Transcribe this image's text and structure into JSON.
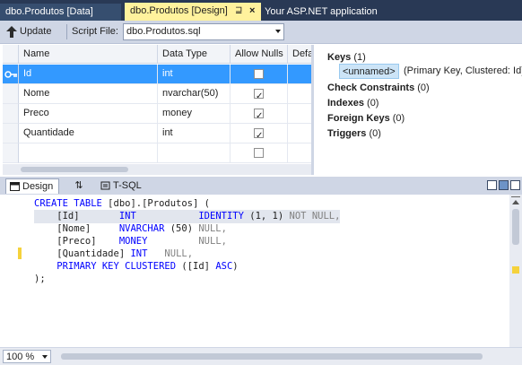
{
  "tabs": [
    {
      "label": "dbo.Produtos [Data]",
      "active": false
    },
    {
      "label": "dbo.Produtos [Design]",
      "active": true,
      "pin": "⊒",
      "close": "×"
    },
    {
      "label": "Your ASP.NET application",
      "active": false
    }
  ],
  "toolbar": {
    "update_label": "Update",
    "script_file_label": "Script File:",
    "script_file_value": "dbo.Produtos.sql"
  },
  "grid": {
    "headers": [
      "Name",
      "Data Type",
      "Allow Nulls",
      "Defa"
    ],
    "rows": [
      {
        "name": "Id",
        "type": "int",
        "allow_nulls": false,
        "key": true
      },
      {
        "name": "Nome",
        "type": "nvarchar(50)",
        "allow_nulls": true,
        "key": false
      },
      {
        "name": "Preco",
        "type": "money",
        "allow_nulls": true,
        "key": false
      },
      {
        "name": "Quantidade",
        "type": "int",
        "allow_nulls": true,
        "key": false
      },
      {
        "name": "",
        "type": "",
        "allow_nulls": false,
        "key": false
      }
    ]
  },
  "properties": {
    "keys": {
      "label": "Keys",
      "count": "(1)"
    },
    "key_item": "<unnamed>",
    "key_desc": "(Primary Key, Clustered: Id)",
    "check_constraints": {
      "label": "Check Constraints",
      "count": "(0)"
    },
    "indexes": {
      "label": "Indexes",
      "count": "(0)"
    },
    "foreign_keys": {
      "label": "Foreign Keys",
      "count": "(0)"
    },
    "triggers": {
      "label": "Triggers",
      "count": "(0)"
    }
  },
  "lower_tabs": {
    "design": "Design",
    "swap": "⇅",
    "tsql": "T-SQL"
  },
  "sql": {
    "l1_kw": "CREATE TABLE",
    "l1_rest": " [dbo].[Produtos] (",
    "l2_col": "    [Id]",
    "l2_type": "INT",
    "l2_ident": "IDENTITY",
    "l2_args": " (1, 1)",
    "l2_null": "NOT NULL,",
    "l3_col": "    [Nome]",
    "l3_type": "NVARCHAR",
    "l3_args": " (50)",
    "l3_null": "NULL,",
    "l4_col": "    [Preco]",
    "l4_type": "MONEY",
    "l4_null": "NULL,",
    "l5_col": "    [Quantidade]",
    "l5_type": "INT",
    "l5_null": "NULL,",
    "l6_kw": "    PRIMARY KEY CLUSTERED",
    "l6_rest": " ([Id]",
    "l6_asc": "ASC",
    "l6_end": ")",
    "l7": ");"
  },
  "status": {
    "zoom": "100 %"
  },
  "colors": {
    "keyword": "#0000ff",
    "gray_keyword": "#808080",
    "selection": "#3399ff",
    "active_tab": "#fff29d",
    "tabstrip": "#293955",
    "change_marker": "#f5d23c"
  }
}
